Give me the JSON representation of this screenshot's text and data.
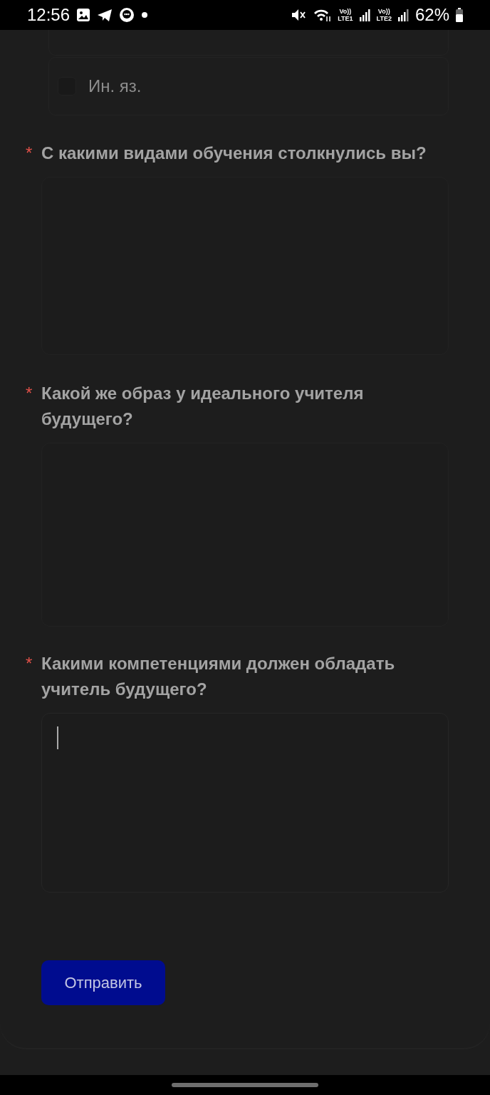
{
  "status_bar": {
    "time": "12:56",
    "volte_1": "Vo))",
    "lte_1": "LTE1",
    "volte_2": "Vo))",
    "lte_2": "LTE2",
    "battery": "62%"
  },
  "options": [
    {
      "label": "Ин. яз.",
      "checked": false
    }
  ],
  "questions": [
    {
      "required_mark": "*",
      "label": "С какими видами обучения столкнулись вы?",
      "focused": false
    },
    {
      "required_mark": "*",
      "label": "Какой же образ у идеального учителя будущего?",
      "focused": false
    },
    {
      "required_mark": "*",
      "label": "Какими компетенциями должен обладать учитель будущего?",
      "focused": true
    }
  ],
  "submit_button": "Отправить"
}
